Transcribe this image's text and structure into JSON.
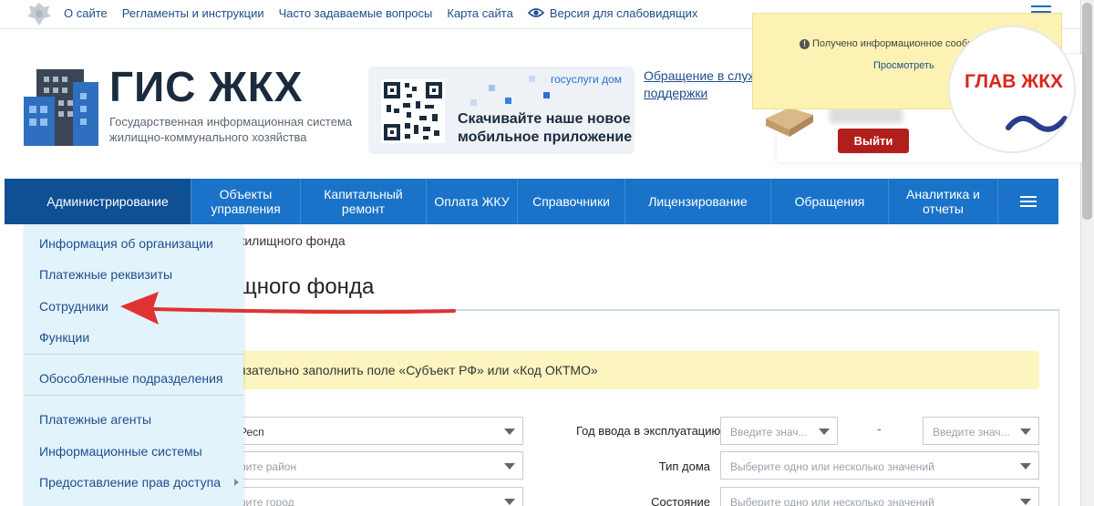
{
  "topbar": {
    "links": [
      "О сайте",
      "Регламенты и инструкции",
      "Часто задаваемые вопросы",
      "Карта сайта"
    ],
    "accessibility_label": "Версия для слабовидящих"
  },
  "header": {
    "logo_title": "ГИС ЖКХ",
    "logo_subtitle": "Государственная информационная система жилищно-коммунального хозяйства",
    "promo_brand": "госуслуги дом",
    "promo_text": "Скачивайте наше новое мобильное приложение",
    "appeal_link": "Обращение в службу поддержки",
    "logout_label": "Выйти"
  },
  "notification": {
    "text": "Получено информационное сообщение",
    "link": "Просмотреть"
  },
  "watermark": {
    "text": "ГЛАВ ЖКХ"
  },
  "nav": {
    "items": [
      "Администрирование",
      "Объекты управления",
      "Капитальный ремонт",
      "Оплата ЖКУ",
      "Справочники",
      "Лицензирование",
      "Обращения",
      "Аналитика и отчеты"
    ]
  },
  "dropdown": {
    "items": [
      "Информация об организации",
      "Платежные реквизиты",
      "Сотрудники",
      "Функции",
      "Обособленные подразделения",
      "Платежные агенты",
      "Информационные системы",
      "Предоставление прав доступа"
    ]
  },
  "content": {
    "breadcrumb_tail": "жилищного фонда",
    "title_tail": "щного фонда",
    "warning_tail": "язательно заполнить поле «Субъект РФ» или «Код ОКТМО»",
    "region_value": "Респ",
    "district_placeholder": "рите район",
    "city_placeholder": "рите город",
    "year_label": "Год ввода в эксплуатацию",
    "year_from_placeholder": "Введите знач...",
    "year_to_placeholder": "Введите знач...",
    "year_separator": "-",
    "house_type_label": "Тип дома",
    "house_type_placeholder": "Выберите одно или несколько значений",
    "state_label": "Состояние",
    "state_placeholder": "Выберите одно или несколько значений"
  },
  "colors": {
    "nav_bg": "#1a73c8",
    "nav_active": "#0f4f94",
    "dropdown_bg": "#e2f3fc",
    "logout_bg": "#b01f1c",
    "arrow": "#e03232",
    "warning_bg": "#fcf5c0"
  }
}
